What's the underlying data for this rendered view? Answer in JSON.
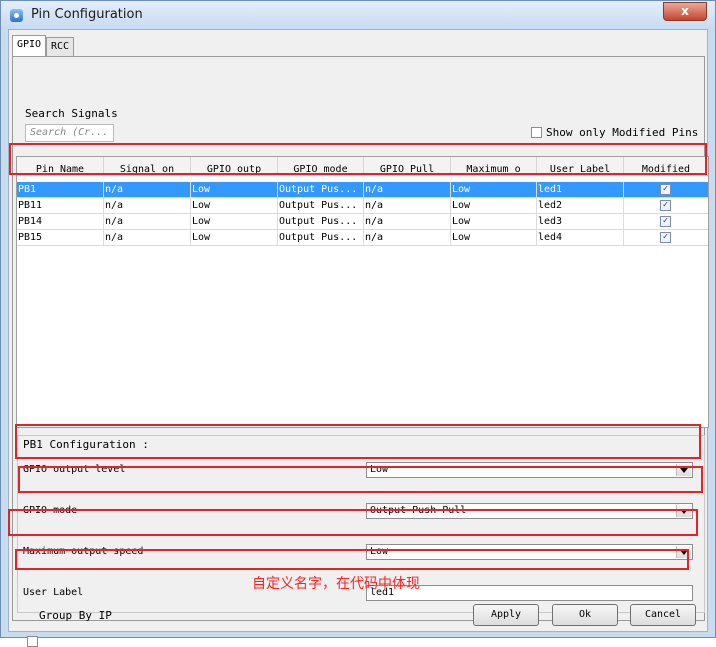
{
  "window": {
    "title": "Pin Configuration",
    "close_symbol": "x"
  },
  "tabs": [
    {
      "label": "GPIO",
      "active": true
    },
    {
      "label": "RCC",
      "active": false
    }
  ],
  "search": {
    "label": "Search Signals",
    "placeholder": "Search (Cr..."
  },
  "show_modified": {
    "label": "Show only Modified Pins",
    "checked": false
  },
  "table": {
    "columns": [
      "Pin Name",
      "Signal on",
      "GPIO outp",
      "GPIO mode",
      "GPIO Pull",
      "Maximum o",
      "User Label",
      "Modified"
    ],
    "rows": [
      {
        "pin": "PB1",
        "signal": "n/a",
        "output": "Low",
        "mode": "Output Pus...",
        "pull": "n/a",
        "speed": "Low",
        "label": "led1",
        "modified": true
      },
      {
        "pin": "PB11",
        "signal": "n/a",
        "output": "Low",
        "mode": "Output Pus...",
        "pull": "n/a",
        "speed": "Low",
        "label": "led2",
        "modified": true
      },
      {
        "pin": "PB14",
        "signal": "n/a",
        "output": "Low",
        "mode": "Output Pus...",
        "pull": "n/a",
        "speed": "Low",
        "label": "led3",
        "modified": true
      },
      {
        "pin": "PB15",
        "signal": "n/a",
        "output": "Low",
        "mode": "Output Pus...",
        "pull": "n/a",
        "speed": "Low",
        "label": "led4",
        "modified": true
      }
    ]
  },
  "config": {
    "title": "PB1 Configuration :",
    "output_level": {
      "label": "GPIO output level",
      "value": "Low"
    },
    "mode": {
      "label": "GPIO mode",
      "value": "Output Push Pull"
    },
    "speed": {
      "label": "Maximum output speed",
      "value": "Low"
    },
    "user_label": {
      "label": "User Label",
      "value": "led1"
    }
  },
  "annotation": "自定义名字，在代码中体现",
  "footer": {
    "group_by_ip": {
      "label": "Group By IP",
      "checked": false
    },
    "apply": "Apply",
    "ok": "Ok",
    "cancel": "Cancel"
  },
  "colors": {
    "selection": "#3399ff",
    "highlight": "#e0242b"
  }
}
